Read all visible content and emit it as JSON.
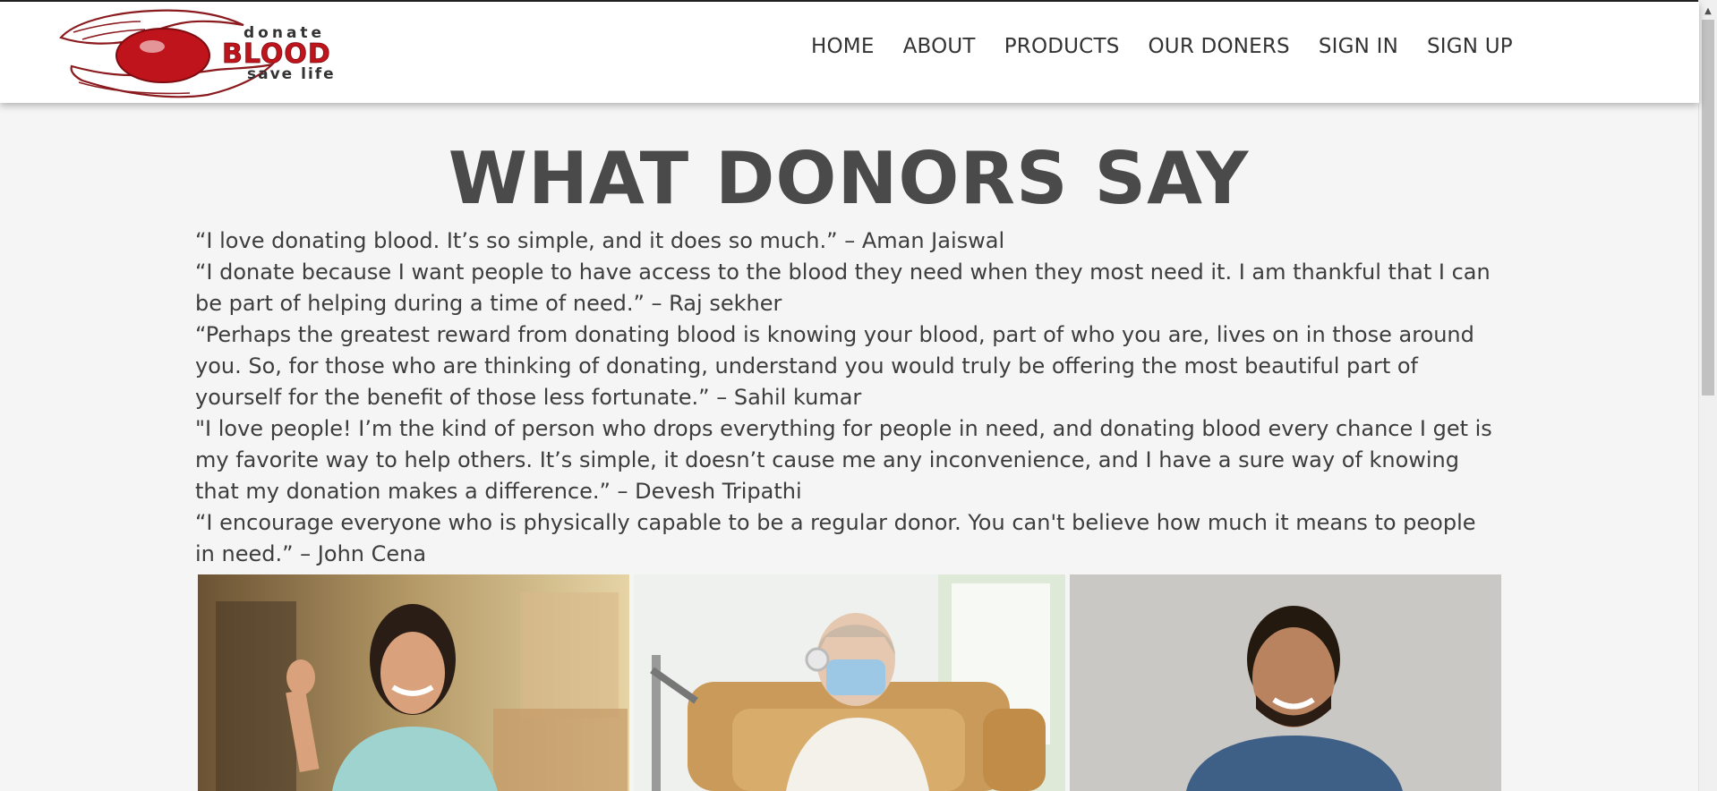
{
  "logo": {
    "top_word": "donate",
    "main_word": "BLOOD",
    "bottom_word": "save life",
    "brand_color": "#c0141c"
  },
  "nav": {
    "items": [
      {
        "label": "HOME"
      },
      {
        "label": "ABOUT"
      },
      {
        "label": "PRODUCTS"
      },
      {
        "label": "OUR DONERS"
      },
      {
        "label": "SIGN IN"
      },
      {
        "label": "SIGN UP"
      }
    ]
  },
  "main": {
    "title": "WHAT DONORS SAY",
    "quotes": [
      "“I love donating blood. It’s so simple, and it does so much.” – Aman Jaiswal",
      "“I donate because I want people to have access to the blood they need when they most need it. I am thankful that I can be part of helping during a time of need.” – Raj sekher",
      "“Perhaps the greatest reward from donating blood is knowing your blood, part of who you are, lives on in those around you. So, for those who are thinking of donating, understand you would truly be offering the most beautiful part of yourself for the benefit of those less fortunate.” – Sahil kumar",
      "\"I love people! I’m the kind of person who drops everything for people in need, and donating blood every chance I get is my favorite way to help others. It’s simple, it doesn’t cause me any inconvenience, and I have a sure way of knowing that my donation makes a difference.” – Devesh Tripathi",
      "“I encourage everyone who is physically capable to be a regular donor. You can't believe how much it means to people in need.” – John Cena"
    ]
  },
  "photos": [
    {
      "icon": "donor-photo-woman-cheering"
    },
    {
      "icon": "donor-photo-patient-donating"
    },
    {
      "icon": "donor-photo-smiling-man"
    }
  ]
}
